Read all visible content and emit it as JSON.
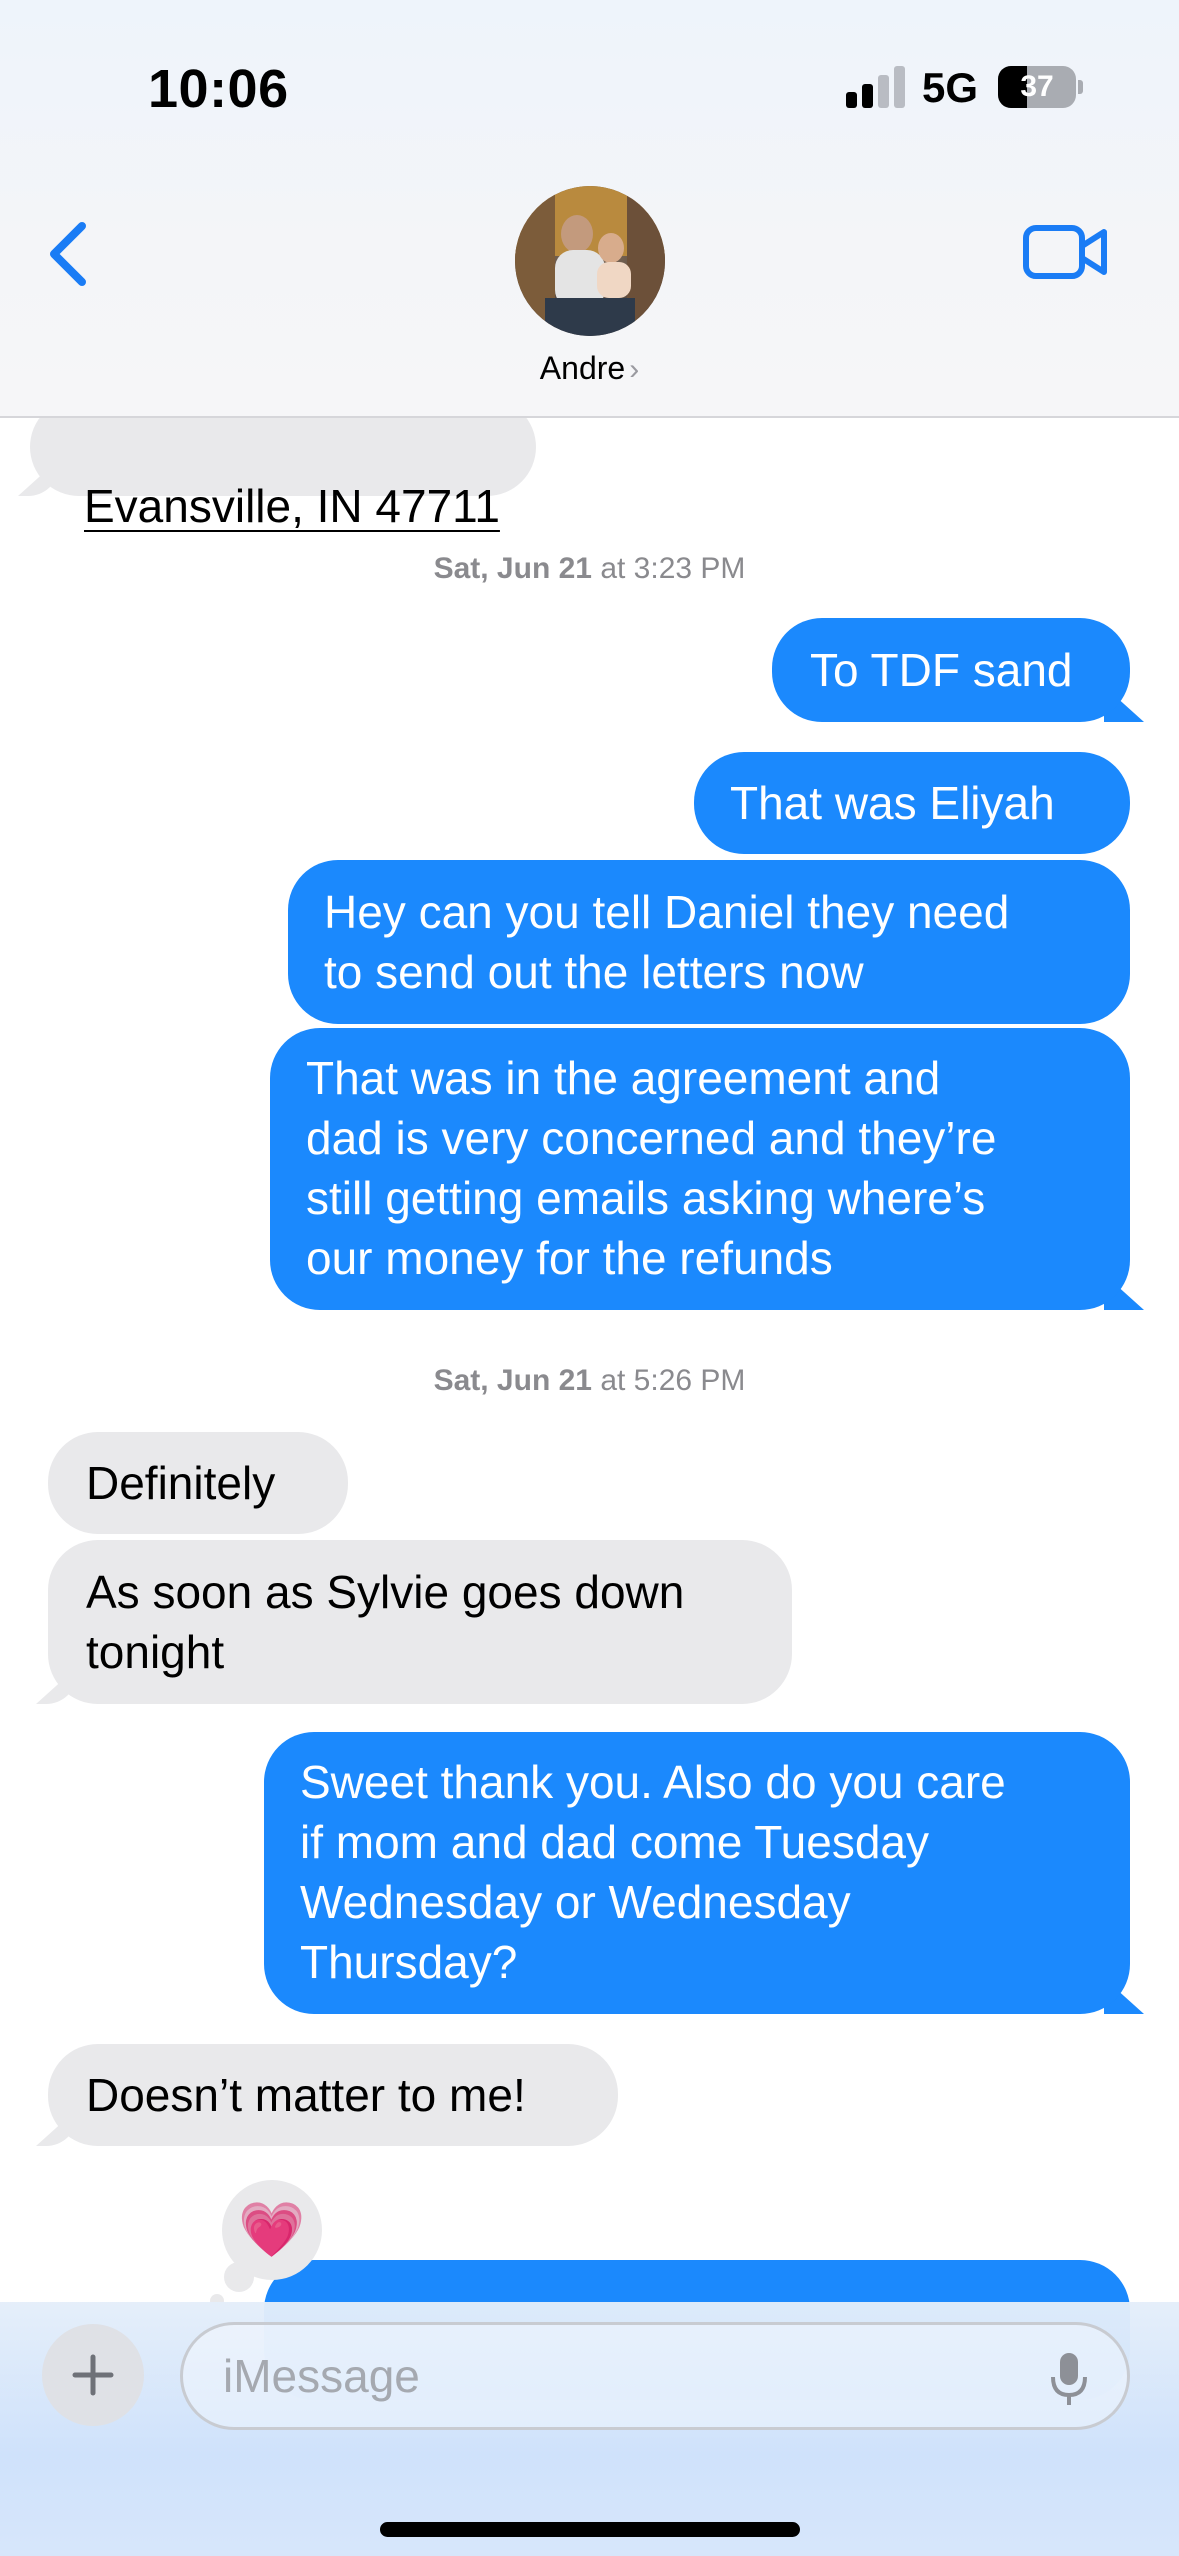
{
  "status_bar": {
    "time": "10:06",
    "network": "5G",
    "battery_percent": "37",
    "signal_bars": 2
  },
  "header": {
    "contact_name": "Andre",
    "back_icon": "chevron-left-icon",
    "video_icon": "video-camera-icon"
  },
  "messages": {
    "m0": "Evansville, IN 47711",
    "ts1_date": "Sat, Jun 21",
    "ts1_time": "at 3:23 PM",
    "m1": "To TDF sand",
    "m2": "That was Eliyah",
    "m3": "Hey can you tell Daniel they need\nto send out the letters now",
    "m4": "That was in the agreement and\ndad is very concerned and they’re\nstill getting emails asking where’s\nour money for the refunds",
    "ts2_date": "Sat, Jun 21",
    "ts2_time": "at 5:26 PM",
    "m5": "Definitely",
    "m6": "As soon as Sylvie goes down\ntonight",
    "m7": "Sweet thank you. Also do you care\nif mom and dad come Tuesday\nWednesday or Wednesday\nThursday?",
    "m8": "Doesn’t matter to me!",
    "reaction": "💗"
  },
  "composer": {
    "placeholder": "iMessage",
    "plus_icon": "plus-icon",
    "mic_icon": "microphone-icon"
  },
  "colors": {
    "outgoing": "#1b89fd",
    "incoming": "#e9e9eb",
    "accent": "#1a7cf5"
  }
}
